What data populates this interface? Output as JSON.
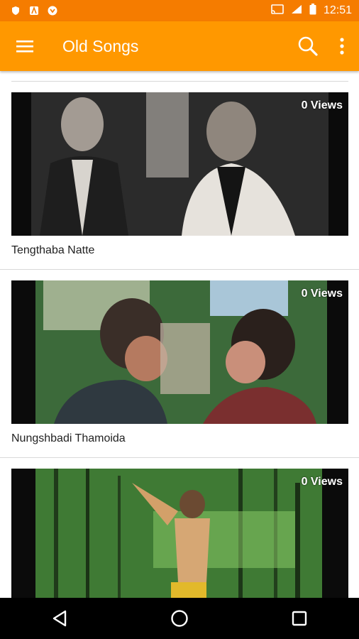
{
  "status_bar": {
    "time": "12:51"
  },
  "app_bar": {
    "title": "Old Songs",
    "menu_icon": "hamburger-menu-icon",
    "search_icon": "search-icon",
    "overflow_icon": "more-vert-icon"
  },
  "videos": [
    {
      "title": "Tengthaba Natte",
      "views": "0 Views"
    },
    {
      "title": "Nungshbadi Thamoida",
      "views": "0 Views"
    },
    {
      "title": "",
      "views": "0 Views"
    }
  ],
  "colors": {
    "status_bar": "#f57c00",
    "app_bar": "#ff9800",
    "nav_bar": "#000000"
  }
}
